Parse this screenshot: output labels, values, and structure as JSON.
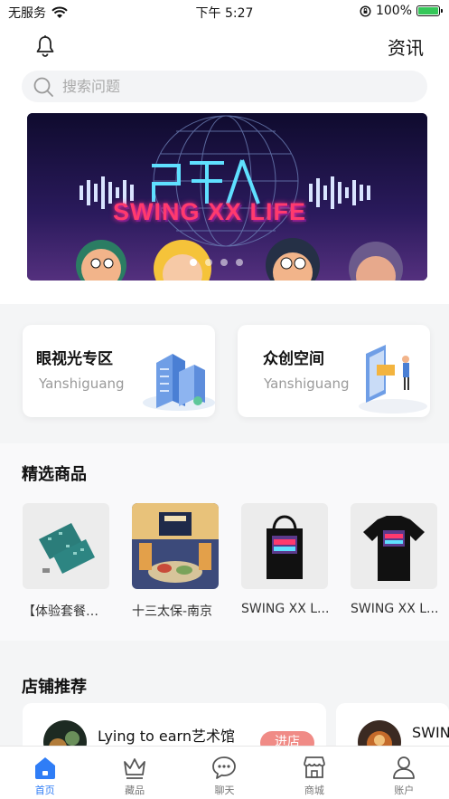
{
  "status_bar": {
    "carrier": "无服务",
    "time": "下午 5:27",
    "battery": "100%"
  },
  "header": {
    "news_label": "资讯"
  },
  "search": {
    "placeholder": "搜索问题"
  },
  "banner": {
    "title": "SWING XX LIFE",
    "slide_count": 4,
    "active_slide": 1
  },
  "zones": [
    {
      "title": "眼视光专区",
      "subtitle": "Yanshiguang"
    },
    {
      "title": "众创空间",
      "subtitle": "Yanshiguang"
    }
  ],
  "featured": {
    "title": "精选商品",
    "products": [
      {
        "name": "【体验套餐…"
      },
      {
        "name": "十三太保-南京"
      },
      {
        "name": "SWING XX L..."
      },
      {
        "name": "SWING XX L..."
      }
    ]
  },
  "shops": {
    "title": "店铺推荐",
    "items": [
      {
        "name": "Lying to earn艺术馆",
        "button": "进店"
      },
      {
        "name": "SWIN"
      }
    ]
  },
  "tabbar": {
    "items": [
      {
        "label": "首页",
        "icon": "home-icon",
        "active": true
      },
      {
        "label": "藏品",
        "icon": "crown-icon",
        "active": false
      },
      {
        "label": "聊天",
        "icon": "chat-icon",
        "active": false
      },
      {
        "label": "商城",
        "icon": "store-icon",
        "active": false
      },
      {
        "label": "账户",
        "icon": "user-icon",
        "active": false
      }
    ]
  },
  "colors": {
    "accent": "#2f7df6",
    "enter_button": "#f08b86",
    "battery": "#35c759"
  }
}
